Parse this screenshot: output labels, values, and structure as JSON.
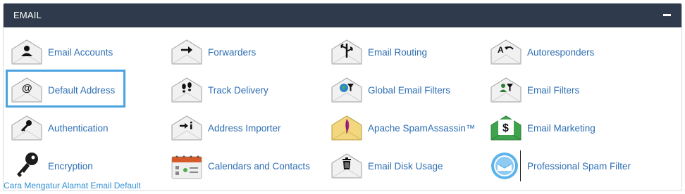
{
  "section": {
    "title": "EMAIL",
    "collapse_label": "–"
  },
  "items": [
    {
      "label": "Email Accounts",
      "icon": "person-envelope-icon"
    },
    {
      "label": "Forwarders",
      "icon": "arrow-envelope-icon"
    },
    {
      "label": "Email Routing",
      "icon": "signpost-envelope-icon"
    },
    {
      "label": "Autoresponders",
      "icon": "autoreply-envelope-icon"
    },
    {
      "label": "Default Address",
      "icon": "at-envelope-icon"
    },
    {
      "label": "Track Delivery",
      "icon": "footprints-envelope-icon"
    },
    {
      "label": "Global Email Filters",
      "icon": "globe-filter-envelope-icon"
    },
    {
      "label": "Email Filters",
      "icon": "person-filter-envelope-icon"
    },
    {
      "label": "Authentication",
      "icon": "key-envelope-icon"
    },
    {
      "label": "Address Importer",
      "icon": "import-envelope-icon"
    },
    {
      "label": "Apache SpamAssassin™",
      "icon": "feather-envelope-icon"
    },
    {
      "label": "Email Marketing",
      "icon": "dollar-envelope-icon"
    },
    {
      "label": "Encryption",
      "icon": "key-icon"
    },
    {
      "label": "Calendars and Contacts",
      "icon": "calendar-icon"
    },
    {
      "label": "Email Disk Usage",
      "icon": "trash-envelope-icon"
    },
    {
      "label": "Professional Spam Filter",
      "icon": "badge-envelope-icon"
    }
  ],
  "caption": "Cara Mengatur Alamat Email Default",
  "colors": {
    "header": "#2f3b4c",
    "link": "#2d6eb3",
    "highlight": "#4aa3e0"
  }
}
